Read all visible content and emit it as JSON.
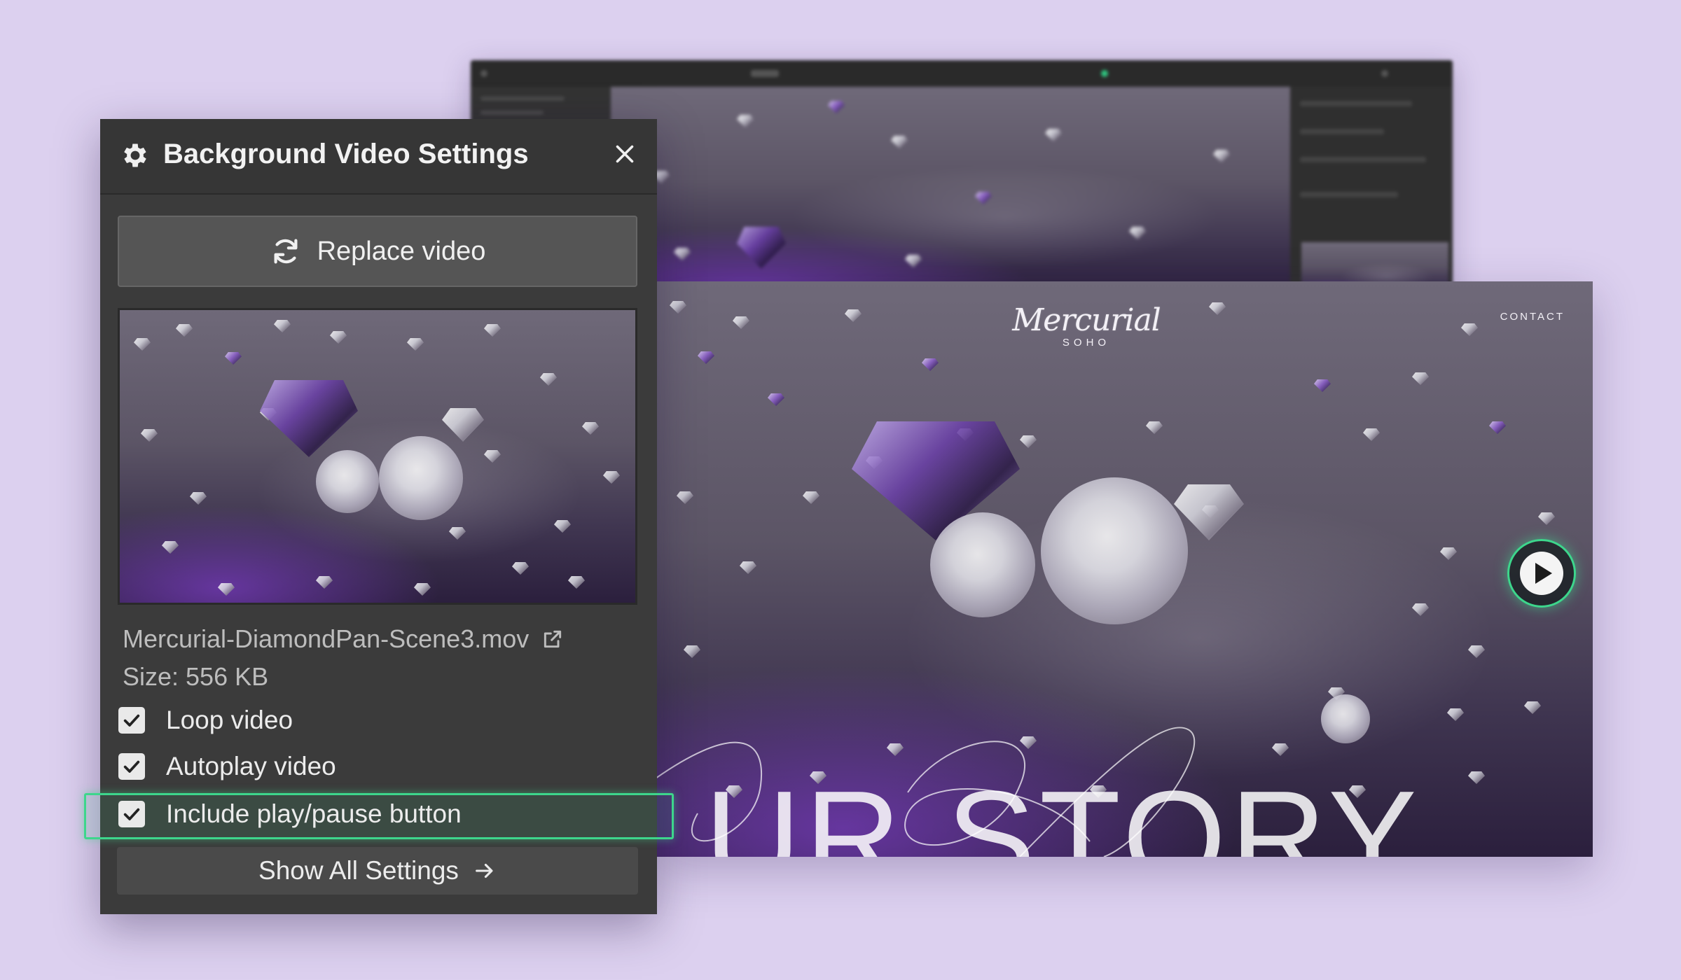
{
  "panel": {
    "title": "Background Video Settings",
    "replace_label": "Replace video",
    "file_name": "Mercurial-DiamondPan-Scene3.mov",
    "file_size": "Size: 556 KB",
    "options": [
      {
        "label": "Loop video",
        "checked": true
      },
      {
        "label": "Autoplay video",
        "checked": true
      },
      {
        "label": "Include play/pause button",
        "checked": true,
        "highlighted": true
      }
    ],
    "show_all_label": "Show All Settings"
  },
  "site": {
    "logo_script": "Mercurial",
    "logo_sub": "SOHO",
    "contact": "CONTACT",
    "headline": "UR STORY"
  },
  "colors": {
    "highlight": "#3dd68c",
    "panel_bg": "#3b3b3b",
    "page_bg": "#dcd0ef"
  },
  "icons": [
    "gear-icon",
    "close-icon",
    "refresh-icon",
    "external-link-icon",
    "check-icon",
    "arrow-right-icon",
    "play-icon"
  ]
}
